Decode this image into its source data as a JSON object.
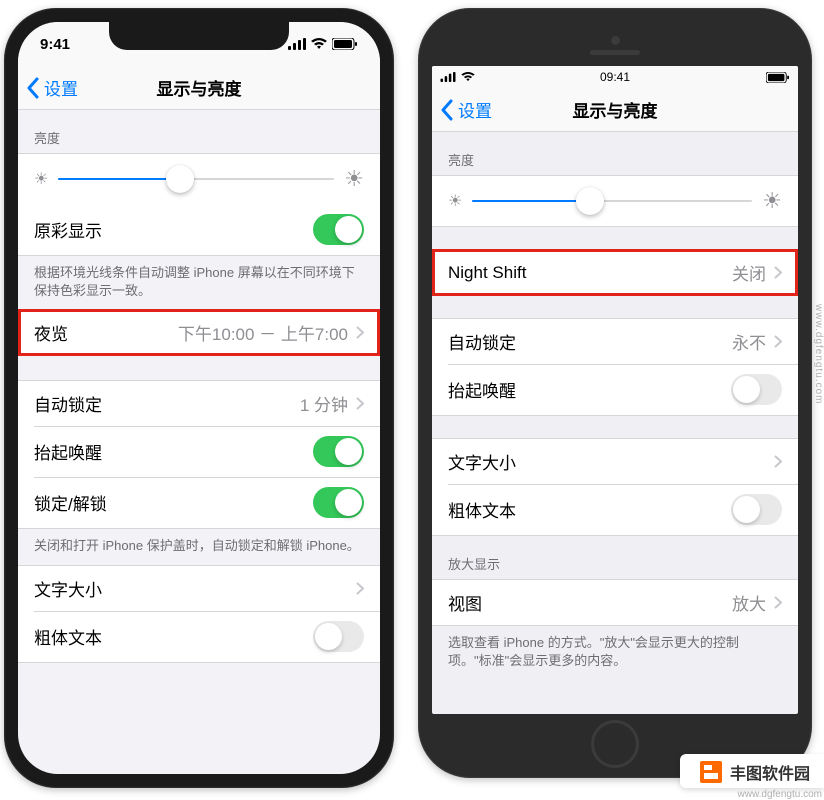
{
  "brand": {
    "name": "丰图软件园",
    "url": "www.dgfengtu.com"
  },
  "phoneX": {
    "status": {
      "time": "9:41"
    },
    "nav": {
      "back": "设置",
      "title": "显示与亮度"
    },
    "brightness_header": "亮度",
    "brightness_pct": 44,
    "rows": {
      "truetone": "原彩显示",
      "truetone_footer": "根据环境光线条件自动调整 iPhone 屏幕以在不同环境下保持色彩显示一致。",
      "nightshift": "夜览",
      "nightshift_val": "下午10:00 － 上午7:00",
      "autolock": "自动锁定",
      "autolock_val": "1 分钟",
      "raise": "抬起唤醒",
      "lockunlock": "锁定/解锁",
      "lockunlock_footer": "关闭和打开 iPhone 保护盖时，自动锁定和解锁 iPhone。",
      "textsize": "文字大小",
      "bold": "粗体文本"
    },
    "toggles": {
      "truetone": true,
      "raise": true,
      "lockunlock": true,
      "bold": false
    }
  },
  "phone8": {
    "status": {
      "time": "09:41"
    },
    "nav": {
      "back": "设置",
      "title": "显示与亮度"
    },
    "brightness_header": "亮度",
    "brightness_pct": 42,
    "rows": {
      "nightshift": "Night Shift",
      "nightshift_val": "关闭",
      "autolock": "自动锁定",
      "autolock_val": "永不",
      "raise": "抬起唤醒",
      "textsize": "文字大小",
      "bold": "粗体文本",
      "zoom_header": "放大显示",
      "zoom": "视图",
      "zoom_val": "放大",
      "zoom_footer": "选取查看 iPhone 的方式。\"放大\"会显示更大的控制项。\"标准\"会显示更多的内容。"
    },
    "toggles": {
      "raise": false,
      "bold": false
    }
  }
}
